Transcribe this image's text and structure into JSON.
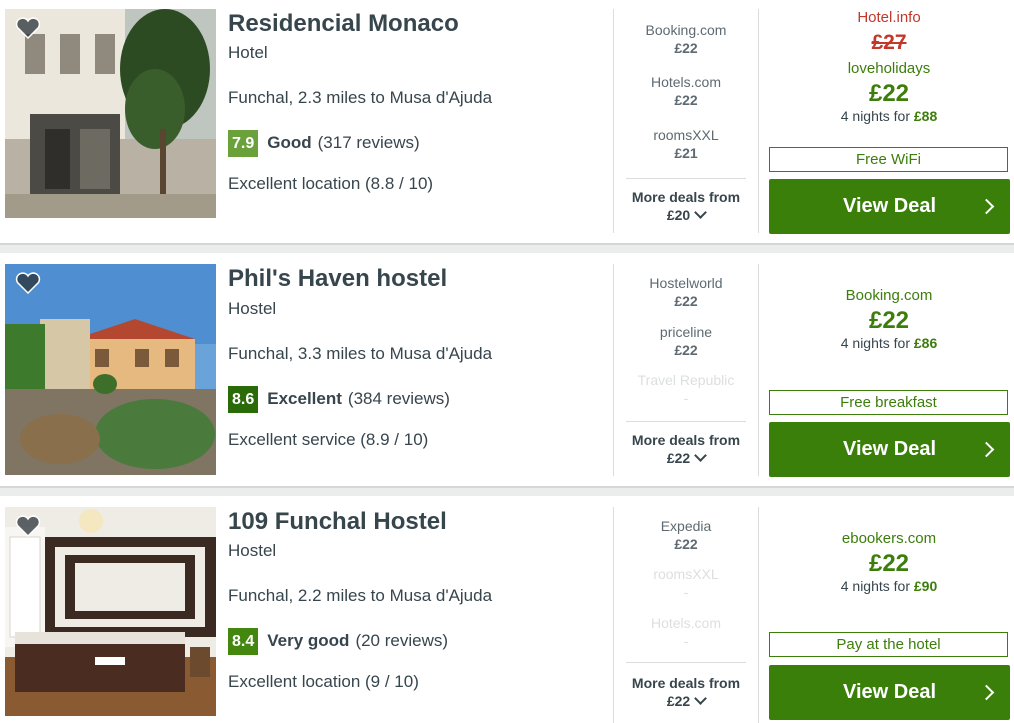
{
  "colors": {
    "accent": "#3c7d0b",
    "button": "#3a7f0a",
    "strike": "#c0392b",
    "score_good": "#6aa13b",
    "score_excellent": "#2a6a09",
    "score_verygood": "#43870f"
  },
  "hotels": [
    {
      "name": "Residencial Monaco",
      "type": "Hotel",
      "location": "Funchal, 2.3 miles to Musa d'Ajuda",
      "score": "7.9",
      "rating_label": "Good",
      "reviews": "(317 reviews)",
      "sub_rating": "Excellent location (8.8 / 10)",
      "deals": [
        {
          "site": "Booking.com",
          "price": "£22",
          "faded": false
        },
        {
          "site": "Hotels.com",
          "price": "£22",
          "faded": false
        },
        {
          "site": "roomsXXL",
          "price": "£21",
          "faded": false
        }
      ],
      "more_label": "More deals from",
      "more_price": "£20",
      "best": {
        "partner_old": "Hotel.info",
        "old_price": "£27",
        "partner": "loveholidays",
        "price": "£22",
        "nights_prefix": "4 nights for",
        "nights_total": "£88"
      },
      "feature": "Free WiFi",
      "cta": "View Deal"
    },
    {
      "name": "Phil's Haven hostel",
      "type": "Hostel",
      "location": "Funchal, 3.3 miles to Musa d'Ajuda",
      "score": "8.6",
      "rating_label": "Excellent",
      "reviews": "(384 reviews)",
      "sub_rating": "Excellent service (8.9 / 10)",
      "deals": [
        {
          "site": "Hostelworld",
          "price": "£22",
          "faded": false
        },
        {
          "site": "priceline",
          "price": "£22",
          "faded": false
        },
        {
          "site": "Travel Republic",
          "price": "-",
          "faded": true
        }
      ],
      "more_label": "More deals from",
      "more_price": "£22",
      "best": {
        "partner": "Booking.com",
        "price": "£22",
        "nights_prefix": "4 nights for",
        "nights_total": "£86"
      },
      "feature": "Free breakfast",
      "cta": "View Deal"
    },
    {
      "name": "109 Funchal Hostel",
      "type": "Hostel",
      "location": "Funchal, 2.2 miles to Musa d'Ajuda",
      "score": "8.4",
      "rating_label": "Very good",
      "reviews": "(20 reviews)",
      "sub_rating": "Excellent location (9 / 10)",
      "deals": [
        {
          "site": "Expedia",
          "price": "£22",
          "faded": false
        },
        {
          "site": "roomsXXL",
          "price": "-",
          "faded": true
        },
        {
          "site": "Hotels.com",
          "price": "-",
          "faded": true
        }
      ],
      "more_label": "More deals from",
      "more_price": "£22",
      "best": {
        "partner": "ebookers.com",
        "price": "£22",
        "nights_prefix": "4 nights for",
        "nights_total": "£90"
      },
      "feature": "Pay at the hotel",
      "cta": "View Deal"
    }
  ]
}
